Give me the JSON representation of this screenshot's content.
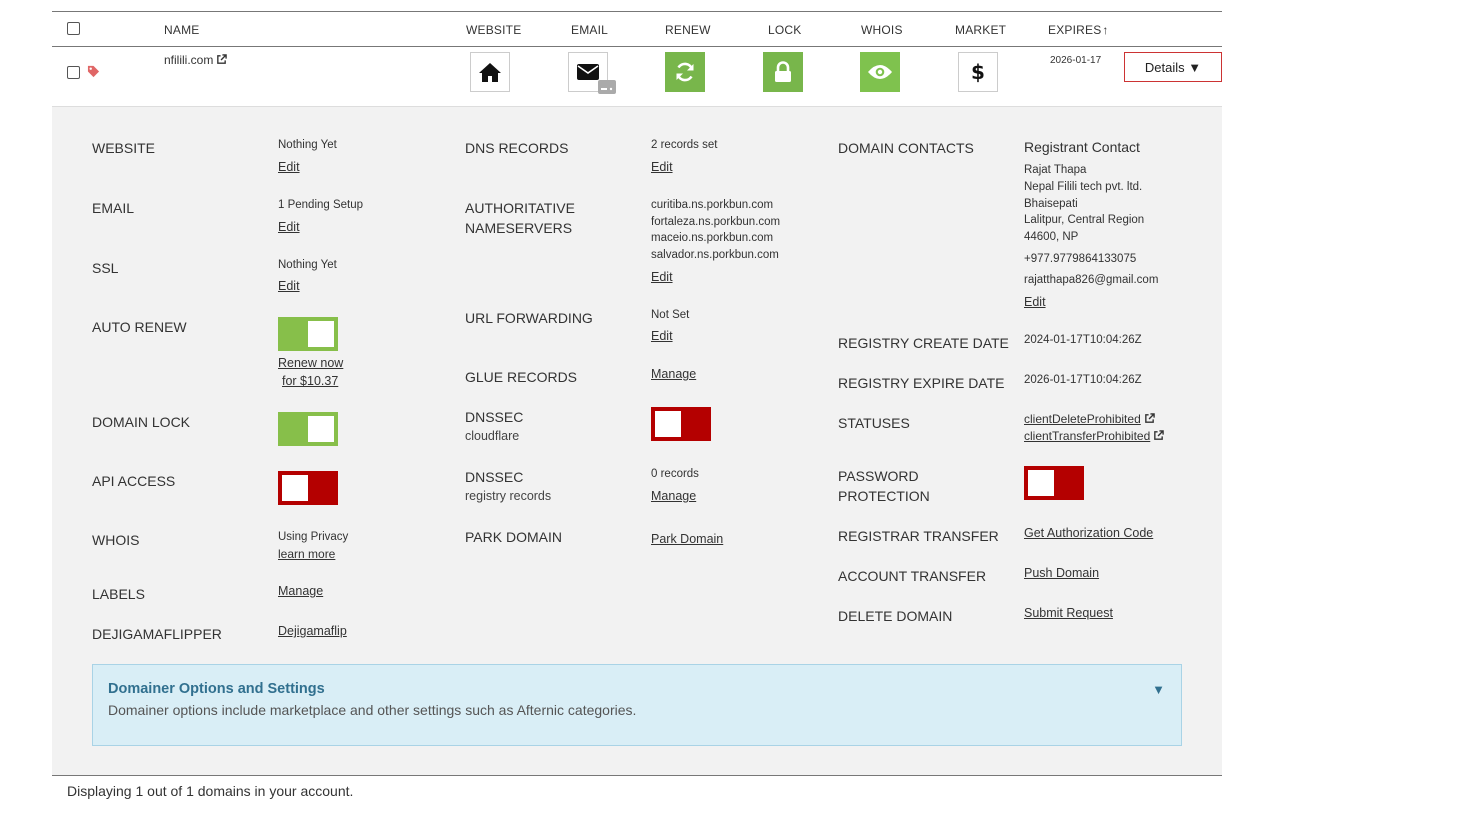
{
  "table": {
    "headers": {
      "name": "NAME",
      "website": "WEBSITE",
      "email": "EMAIL",
      "renew": "RENEW",
      "lock": "LOCK",
      "whois": "WHOIS",
      "market": "MARKET",
      "expires": "EXPIRES"
    },
    "sort_arrow": "↑",
    "row": {
      "domain": "nfilili.com",
      "expires": "2026-01-17",
      "details_label": "Details ▼",
      "icons": [
        "home-icon",
        "envelope-icon",
        "refresh-icon",
        "lock-icon",
        "eye-icon",
        "dollar-icon"
      ]
    }
  },
  "details": {
    "col1": {
      "website_label": "WEBSITE",
      "website_value": "Nothing Yet",
      "website_link": "Edit",
      "email_label": "EMAIL",
      "email_value": "1 Pending Setup",
      "email_link": "Edit",
      "ssl_label": "SSL",
      "ssl_value": "Nothing Yet",
      "ssl_link": "Edit",
      "auto_renew_label": "AUTO RENEW",
      "auto_renew_state": "on",
      "renew_link_1": "Renew now",
      "renew_link_2": "for $10.37",
      "domain_lock_label": "DOMAIN LOCK",
      "domain_lock_state": "on",
      "api_access_label": "API ACCESS",
      "api_access_state": "off",
      "whois_label": "WHOIS",
      "whois_value": "Using Privacy",
      "whois_link": "learn more",
      "labels_label": "LABELS",
      "labels_link": "Manage",
      "dejigama_label": "DEJIGAMAFLIPPER",
      "dejigama_link": "Dejigamaflip"
    },
    "col2": {
      "dns_label": "DNS RECORDS",
      "dns_value": "2 records set",
      "dns_link": "Edit",
      "ns_label_1": "AUTHORITATIVE",
      "ns_label_2": "NAMESERVERS",
      "nameservers": [
        "curitiba.ns.porkbun.com",
        "fortaleza.ns.porkbun.com",
        "maceio.ns.porkbun.com",
        "salvador.ns.porkbun.com"
      ],
      "ns_link": "Edit",
      "url_fwd_label": "URL FORWARDING",
      "url_fwd_value": "Not Set",
      "url_fwd_link": "Edit",
      "glue_label": "GLUE RECORDS",
      "glue_link": "Manage",
      "dnssec_cf_label": "DNSSEC",
      "dnssec_cf_sub": "cloudflare",
      "dnssec_cf_state": "off",
      "dnssec_reg_label": "DNSSEC",
      "dnssec_reg_sub": "registry records",
      "dnssec_reg_value": "0 records",
      "dnssec_reg_link": "Manage",
      "park_label": "PARK DOMAIN",
      "park_link": "Park Domain"
    },
    "col3": {
      "contacts_label": "DOMAIN CONTACTS",
      "contact_title": "Registrant Contact",
      "contact_lines": [
        "Rajat Thapa",
        "Nepal Filili tech pvt. ltd.",
        "Bhaisepati",
        "Lalitpur, Central Region",
        "44600, NP"
      ],
      "contact_phone": "+977.9779864133075",
      "contact_email": "rajatthapa826@gmail.com",
      "contact_link": "Edit",
      "create_label": "REGISTRY CREATE DATE",
      "create_value": "2024-01-17T10:04:26Z",
      "expire_label": "REGISTRY EXPIRE DATE",
      "expire_value": "2026-01-17T10:04:26Z",
      "statuses_label": "STATUSES",
      "statuses": [
        "clientDeleteProhibited",
        "clientTransferProhibited"
      ],
      "password_label_1": "PASSWORD",
      "password_label_2": "PROTECTION",
      "password_state": "off",
      "transfer_label": "REGISTRAR TRANSFER",
      "transfer_link": "Get Authorization Code",
      "account_transfer_label": "ACCOUNT TRANSFER",
      "account_transfer_link": "Push Domain",
      "delete_label": "DELETE DOMAIN",
      "delete_link": "Submit Request"
    }
  },
  "domainer": {
    "title": "Domainer Options and Settings",
    "description": "Domainer options include marketplace and other settings such as Afternic categories.",
    "arrow": "▼"
  },
  "footer": "Displaying 1 out of 1 domains in your account.",
  "colors": {
    "toggle_on": "#87bf4a",
    "toggle_off": "#b40000",
    "action_green": "#78b64b",
    "panel_bg": "#f2f2f2",
    "info_bg": "#d9eef6",
    "info_text": "#31708f"
  }
}
